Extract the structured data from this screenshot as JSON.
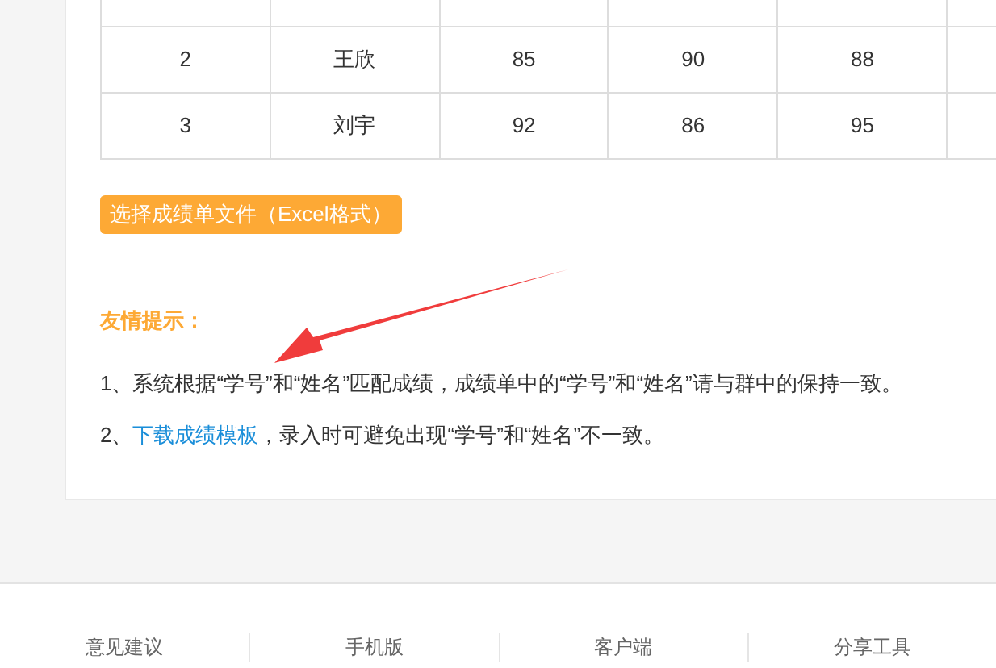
{
  "table": {
    "rows": [
      {
        "cells": [
          "2",
          "王欣",
          "85",
          "90",
          "88"
        ]
      },
      {
        "cells": [
          "3",
          "刘宇",
          "92",
          "86",
          "95"
        ]
      }
    ]
  },
  "upload_button": "选择成绩单文件（Excel格式）",
  "tips": {
    "title": "友情提示：",
    "lines": [
      {
        "kind": "plain",
        "text": "1、系统根据“学号”和“姓名”匹配成绩，成绩单中的“学号”和“姓名”请与群中的保持一致。"
      },
      {
        "kind": "link",
        "prefix": "2、",
        "link": "下载成绩模板",
        "text": "，录入时可避免出现“学号”和“姓名”不一致。"
      }
    ]
  },
  "footer": {
    "links": [
      "意见建议",
      "手机版",
      "客户端",
      "分享工具"
    ]
  }
}
